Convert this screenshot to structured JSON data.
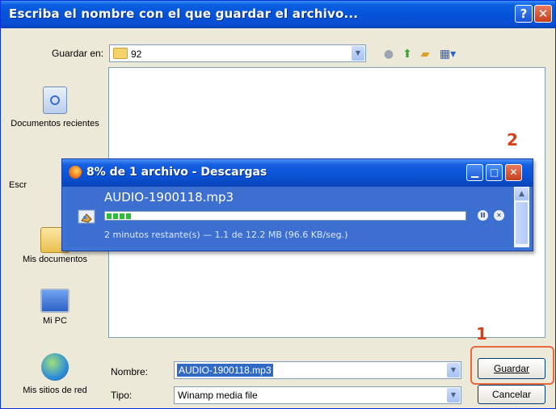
{
  "dialog": {
    "title": "Escriba el nombre con el que guardar el archivo...",
    "help_label": "?",
    "close_label": "✕",
    "save_in_label": "Guardar en:",
    "save_in_value": "92",
    "places": [
      "Documentos recientes",
      "Escr",
      "Mis documentos",
      "Mi PC",
      "Mis sitios de red"
    ],
    "filename_label": "Nombre:",
    "filename_value": "AUDIO-1900118.mp3",
    "filetype_label": "Tipo:",
    "filetype_value": "Winamp media file",
    "save_button": "Guardar",
    "cancel_button": "Cancelar",
    "accent_color": "#0a5fe0",
    "highlight_color": "#e8693a"
  },
  "annotations": {
    "marker_1": "1",
    "marker_2": "2"
  },
  "downloads": {
    "title": "8% de 1 archivo - Descargas",
    "file_name": "AUDIO-1900118.mp3",
    "progress_fraction": 0.08,
    "status": "2 minutos restante(s) — 1.1 de 12.2 MB (96.6 KB/seg.)",
    "pause_icon": "pause-icon",
    "cancel_icon": "cancel-icon"
  }
}
